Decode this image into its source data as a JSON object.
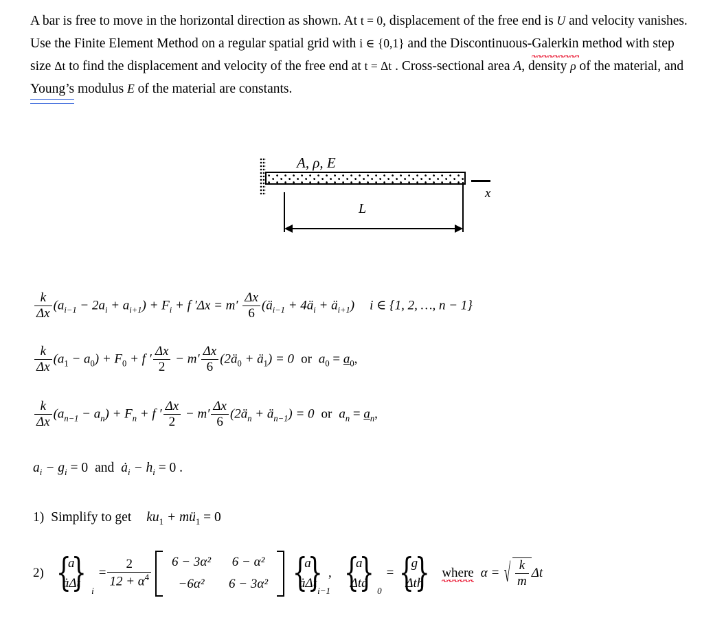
{
  "document": {
    "type": "math-homework-problem",
    "background": "#ffffff",
    "text_color": "#000000",
    "spellcheck_red": "#e8112d",
    "grammar_blue": "#1a4fd6"
  },
  "problem_statement": {
    "s1": "A bar is free to move in the horizontal direction as shown. At ",
    "m1": "t = 0",
    "s2": ", displacement of the free end is ",
    "m2": "U",
    "s3": " and velocity vanishes. Use the Finite Element Method on a regular spatial grid with ",
    "m3": "i ∈ {0,1}",
    "s4": " and the Discontinuous-",
    "misspelled_word": "Galerkin",
    "s5": " method with step size ",
    "m4": "Δt",
    "s6": " to find the displacement and velocity of the free end at ",
    "m5": "t = Δt",
    "s7": " . Cross-sectional area ",
    "m6": "A",
    "s8": ", density ",
    "m7": "ρ",
    "s9": " of the material, and ",
    "grammar_word": "Young’s",
    "s10": " modulus ",
    "m8": "E",
    "s11": " of the material are constants."
  },
  "figure": {
    "name": "free-bar-schematic",
    "bar_properties_label": "A, ρ, E",
    "length_label": "L",
    "axis_label": "x",
    "wall_style": "dotted-fixed-support",
    "bar_fill": "dotted"
  },
  "equations": {
    "interior": {
      "id": "interior-node-equation",
      "k": "k",
      "dx": "Δx",
      "lhs_paren": "(a",
      "a_im1_sub": "i−1",
      "minus2a": " − 2a",
      "a_i_sub": "i",
      "plus_a": " + a",
      "a_ip1_sub": "i+1",
      "close_paren": ")",
      "plus_F": " + F",
      "F_sub": "i",
      "plus_fprime": " + f ′Δx = m′ ",
      "frac_num": "Δx",
      "frac_den": "6",
      "rhs_paren_open": "(ä",
      "add_im1": "i−1",
      "plus4a": " + 4ä",
      "add_i": "i",
      "plus_add": " + ä",
      "add_ip1": "i+1",
      "rhs_paren_close": ")",
      "range": "i ∈ {1, 2, …, n − 1}"
    },
    "left_bc": {
      "id": "left-boundary-equation",
      "k": "k",
      "dx": "Δx",
      "term1_open": "(a",
      "a1_sub": "1",
      "minus_a0": " − a",
      "a0_sub": "0",
      "term1_close": ")",
      "plus_F0": " + F",
      "F0_sub": "0",
      "plus_fp": " + f ′",
      "f_num": "Δx",
      "f_den": "2",
      "minus_mp": " − m′",
      "m_num": "Δx",
      "m_den": "6",
      "acc_open": "(2ä",
      "acc0_sub": "0",
      "acc_plus": " + ä",
      "acc1_sub": "1",
      "acc_close": ") = 0",
      "or": "or",
      "prescribed_lhs": "a",
      "prescribed_lhs_sub": "0",
      "equals": " = ",
      "prescribed_rhs": "a",
      "prescribed_rhs_sub": "0",
      "trailing": ","
    },
    "right_bc": {
      "id": "right-boundary-equation",
      "k": "k",
      "dx": "Δx",
      "term1_open": "(a",
      "an1_sub": "n−1",
      "minus_an": " − a",
      "an_sub": "n",
      "term1_close": ")",
      "plus_Fn": " + F",
      "Fn_sub": "n",
      "plus_fp": " + f ′",
      "f_num": "Δx",
      "f_den": "2",
      "minus_mp": " − m′",
      "m_num": "Δx",
      "m_den": "6",
      "acc_open": "(2ä",
      "accn_sub": "n",
      "acc_plus": " + ä",
      "accn1_sub": "n−1",
      "acc_close": ") = 0",
      "or": "or",
      "prescribed_lhs": "a",
      "prescribed_lhs_sub": "n",
      "equals": " = ",
      "prescribed_rhs": "a",
      "prescribed_rhs_sub": "n",
      "trailing": ","
    },
    "jump_conditions": {
      "id": "jump-conditions",
      "p1": "a",
      "p1_sub": "i",
      "p2": " − g",
      "p2_sub": "i",
      "p3": " = 0",
      "and": "and",
      "p4": "ȧ",
      "p4_sub": "i",
      "p5": " − h",
      "p5_sub": "i",
      "p6": " = 0 ."
    }
  },
  "steps": {
    "step1": {
      "number": "1)",
      "text": "Simplify to get",
      "equation_k": "ku",
      "equation_k_sub": "1",
      "equation_plus": " + mü",
      "equation_m_sub": "1",
      "equation_tail": " = 0"
    },
    "step2": {
      "number": "2)",
      "vector_i": {
        "row1": "a",
        "row2": "ȧΔt",
        "subscript": "i"
      },
      "equals": "=",
      "scalar_fraction": {
        "numerator": "2",
        "denominator_base": "12 + α",
        "denominator_exp": "4"
      },
      "matrix": {
        "rows": [
          [
            "6 − 3α²",
            "6 − α²"
          ],
          [
            "−6α²",
            "6 − 3α²"
          ]
        ]
      },
      "vector_im1": {
        "row1": "a",
        "row2": "ȧΔt",
        "subscript": "i−1"
      },
      "comma": ",",
      "vector_0": {
        "row1": "a",
        "row2": "Δtȧ",
        "subscript": "0"
      },
      "equals2": "=",
      "vector_gh": {
        "row1": "g",
        "row2": "Δth"
      },
      "where_word": "where",
      "alpha_def_lhs": "α  = ",
      "alpha_sqrt_num": "k",
      "alpha_sqrt_den": "m",
      "alpha_dt": "Δt"
    }
  }
}
